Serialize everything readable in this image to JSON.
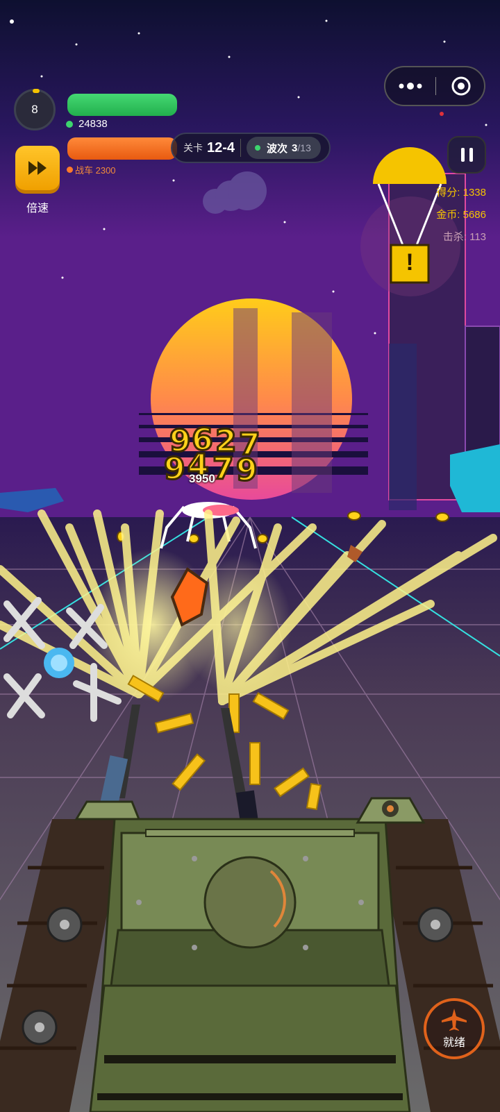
{
  "hud": {
    "level": "8",
    "hp_value": "24838",
    "chariot_label": "战车 2300",
    "speed_label": "倍速",
    "stage_label": "关卡",
    "stage_value": "12-4",
    "wave_label": "波次",
    "wave_current": "3",
    "wave_total": "/13",
    "score_label": "得分: 1338",
    "gold_label": "金币: 5686",
    "kills_label": "击杀: 113",
    "ready_label": "就绪",
    "damage_number": "3950",
    "airdrop_mark": "!"
  },
  "colors": {
    "hp": "#2ecc5e",
    "chariot": "#f26b1d",
    "speed_button": "#f7b500",
    "score_text": "#f5c400",
    "kills_text": "#c9a0b5",
    "ready_ring": "#e0621b"
  },
  "icons": [
    "fast-forward-icon",
    "pause-icon",
    "more-dots-icon",
    "target-icon",
    "airplane-icon",
    "parachute-crate-icon"
  ]
}
